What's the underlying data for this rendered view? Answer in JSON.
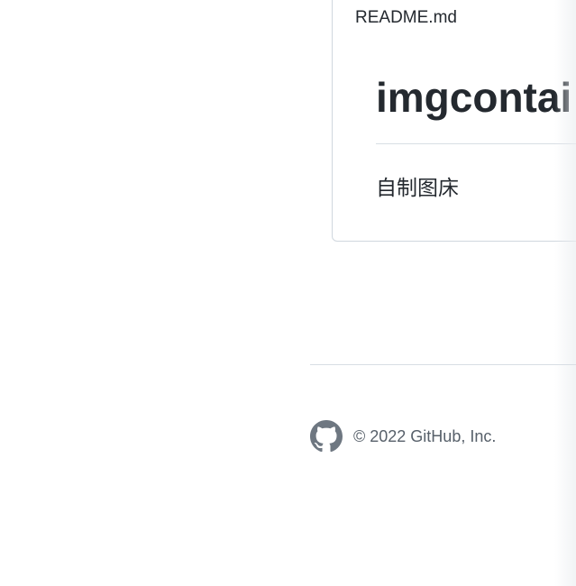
{
  "readme": {
    "filename": "README.md",
    "heading": "imgcontai",
    "description": "自制图床"
  },
  "footer": {
    "logo_icon": "github-mark-icon",
    "copyright": "© 2022 GitHub, Inc."
  },
  "colors": {
    "text": "#24292f",
    "muted": "#57606a",
    "border": "#d0d7de",
    "logo": "#6e7781"
  }
}
